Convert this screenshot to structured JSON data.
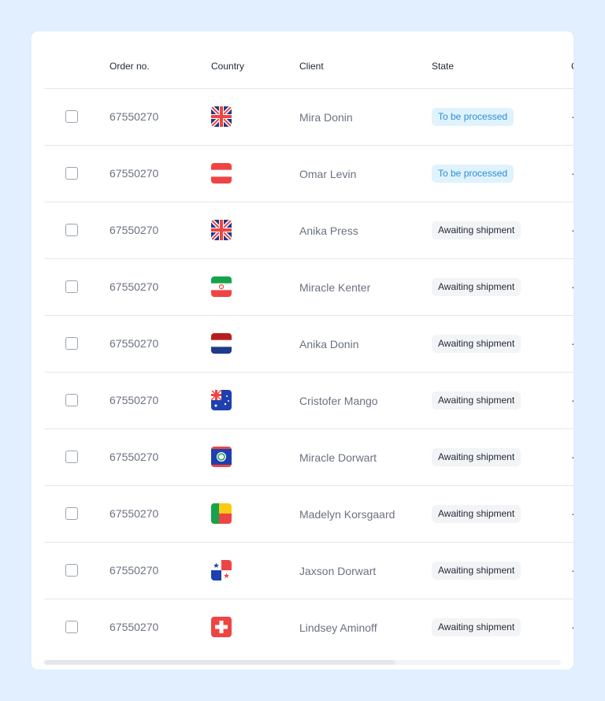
{
  "headers": {
    "order": "Order no.",
    "country": "Country",
    "client": "Client",
    "state": "State",
    "next_partial": "C"
  },
  "rows": [
    {
      "order": "67550270",
      "flag": "united-kingdom",
      "client": "Mira Donin",
      "state": "To be processed",
      "state_type": "processed"
    },
    {
      "order": "67550270",
      "flag": "austria",
      "client": "Omar Levin",
      "state": "To be processed",
      "state_type": "processed"
    },
    {
      "order": "67550270",
      "flag": "united-kingdom",
      "client": "Anika Press",
      "state": "Awaiting shipment",
      "state_type": "awaiting"
    },
    {
      "order": "67550270",
      "flag": "iran",
      "client": "Miracle Kenter",
      "state": "Awaiting shipment",
      "state_type": "awaiting"
    },
    {
      "order": "67550270",
      "flag": "netherlands",
      "client": "Anika Donin",
      "state": "Awaiting shipment",
      "state_type": "awaiting"
    },
    {
      "order": "67550270",
      "flag": "australia",
      "client": "Cristofer Mango",
      "state": "Awaiting shipment",
      "state_type": "awaiting"
    },
    {
      "order": "67550270",
      "flag": "belize",
      "client": "Miracle Dorwart",
      "state": "Awaiting shipment",
      "state_type": "awaiting"
    },
    {
      "order": "67550270",
      "flag": "benin",
      "client": "Madelyn Korsgaard",
      "state": "Awaiting shipment",
      "state_type": "awaiting"
    },
    {
      "order": "67550270",
      "flag": "panama",
      "client": "Jaxson Dorwart",
      "state": "Awaiting shipment",
      "state_type": "awaiting"
    },
    {
      "order": "67550270",
      "flag": "switzerland",
      "client": "Lindsey Aminoff",
      "state": "Awaiting shipment",
      "state_type": "awaiting"
    }
  ],
  "colors": {
    "background": "#e1effe",
    "processed_bg": "#e0f2fe",
    "processed_text": "#2b8fd4",
    "awaiting_bg": "#f3f4f6",
    "awaiting_text": "#1f2937"
  }
}
